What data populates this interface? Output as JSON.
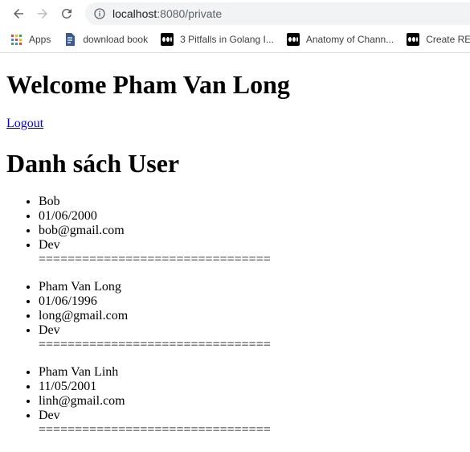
{
  "browser": {
    "url_host": "localhost",
    "url_rest": ":8080/private",
    "bookmarks": [
      {
        "label": "Apps",
        "icon": "apps-grid-icon"
      },
      {
        "label": "download book",
        "icon": "file-icon"
      },
      {
        "label": "3 Pitfalls in Golang I...",
        "icon": "medium-icon"
      },
      {
        "label": "Anatomy of Chann...",
        "icon": "medium-icon"
      },
      {
        "label": "Create RES",
        "icon": "medium-icon"
      }
    ]
  },
  "page": {
    "welcome": "Welcome Pham Van Long",
    "logout": "Logout",
    "list_title": "Danh sách User",
    "separator": "================================",
    "users": [
      {
        "name": "Bob",
        "dob": "01/06/2000",
        "email": "bob@gmail.com",
        "role": "Dev"
      },
      {
        "name": "Pham Van Long",
        "dob": "01/06/1996",
        "email": "long@gmail.com",
        "role": "Dev"
      },
      {
        "name": "Pham Van Linh",
        "dob": "11/05/2001",
        "email": "linh@gmail.com",
        "role": "Dev"
      }
    ]
  }
}
